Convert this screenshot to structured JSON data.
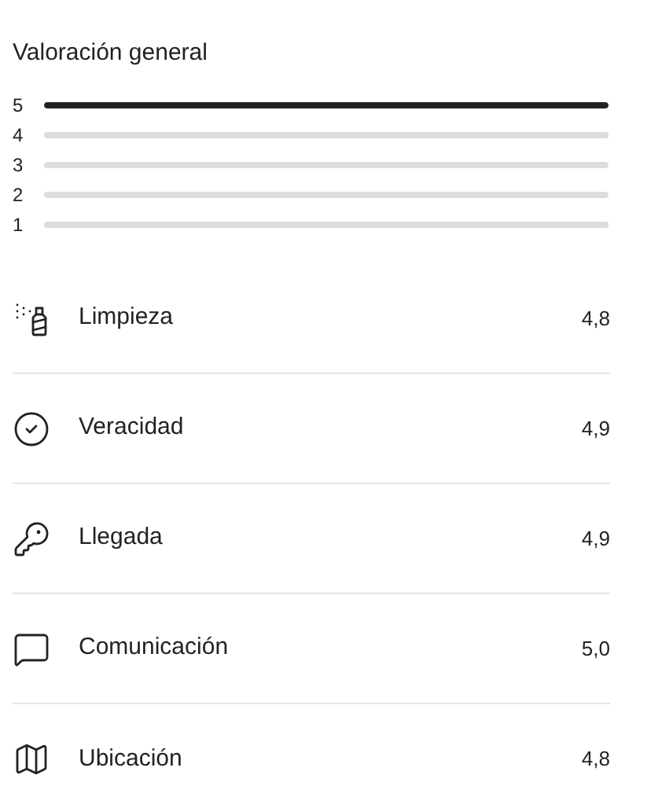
{
  "title": "Valoración general",
  "distribution": [
    {
      "label": "5",
      "level": 1
    },
    {
      "label": "4",
      "level": 0
    },
    {
      "label": "3",
      "level": 0
    },
    {
      "label": "2",
      "level": 0
    },
    {
      "label": "1",
      "level": 0
    }
  ],
  "categories": [
    {
      "kind": "spray",
      "label": "Limpieza",
      "score": "4,8"
    },
    {
      "kind": "check",
      "label": "Veracidad",
      "score": "4,9"
    },
    {
      "kind": "key",
      "label": "Llegada",
      "score": "4,9"
    },
    {
      "kind": "chat",
      "label": "Comunicación",
      "score": "5,0"
    },
    {
      "kind": "map",
      "label": "Ubicación",
      "score": "4,8"
    }
  ]
}
